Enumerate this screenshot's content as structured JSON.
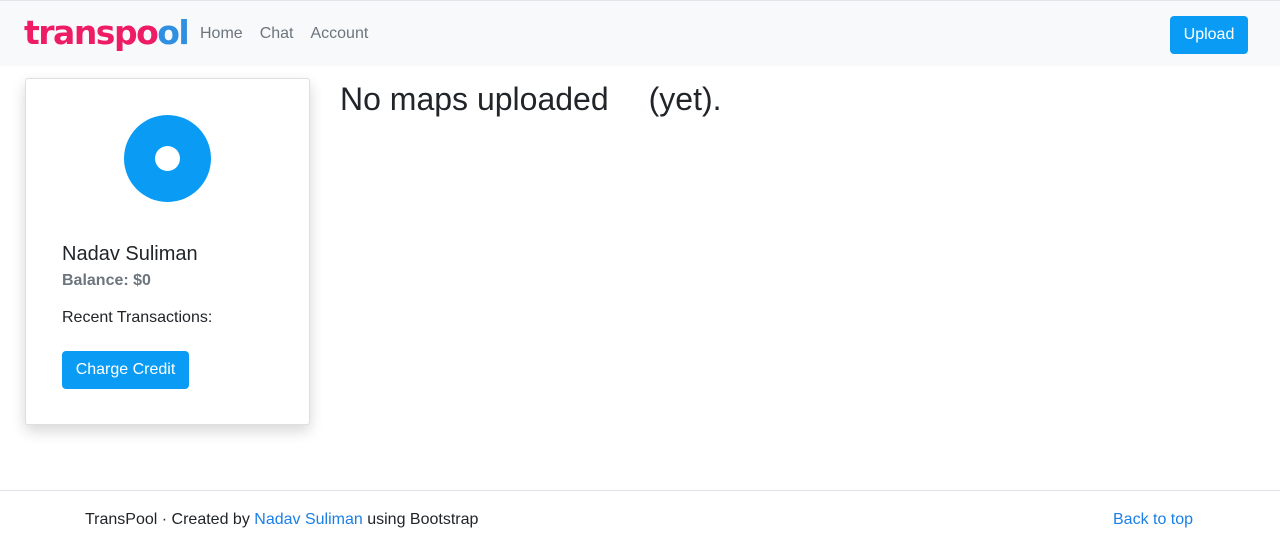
{
  "navbar": {
    "logo_part1": "transpo",
    "logo_part2": "ol",
    "links": [
      "Home",
      "Chat",
      "Account"
    ],
    "upload_label": "Upload"
  },
  "profile": {
    "name": "Nadav Suliman",
    "balance_label": "Balance:",
    "balance_value": "$0",
    "recent_transactions_label": "Recent Transactions:",
    "charge_button_label": "Charge Credit"
  },
  "main": {
    "heading_part1": "No maps uploaded",
    "heading_part2": "(yet)."
  },
  "footer": {
    "brand": "TransPool",
    "separator": " · Created by ",
    "author_link": "Nadav Suliman",
    "suffix": " using Bootstrap",
    "back_to_top": "Back to top"
  },
  "colors": {
    "primary": "#0a9cf5",
    "logo_pink": "#ee1c64",
    "logo_blue": "#2f8fe0",
    "link": "#1a7fe8"
  }
}
